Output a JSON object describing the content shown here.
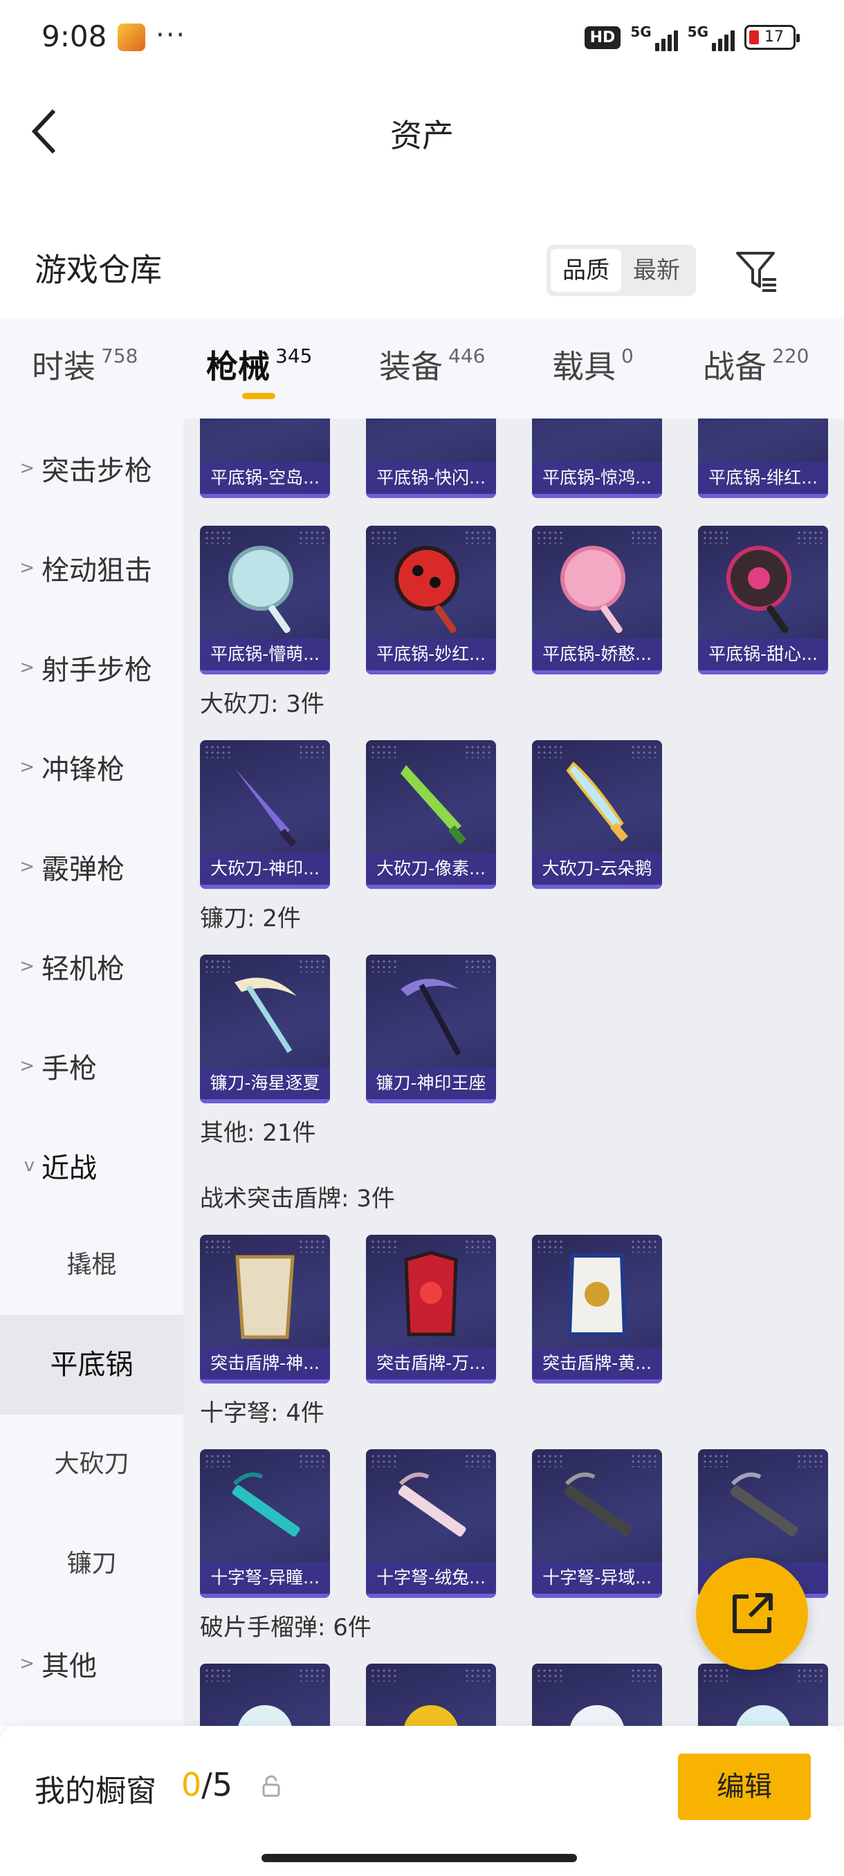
{
  "status_bar": {
    "time": "9:08",
    "dots": "···",
    "hd": "HD",
    "net1": "5G",
    "net2": "5G",
    "battery": "17"
  },
  "header": {
    "title": "资产"
  },
  "warehouse": {
    "title": "游戏仓库",
    "sort_quality": "品质",
    "sort_newest": "最新"
  },
  "tabs": [
    {
      "label": "时装",
      "count": "758"
    },
    {
      "label": "枪械",
      "count": "345"
    },
    {
      "label": "装备",
      "count": "446"
    },
    {
      "label": "载具",
      "count": "0"
    },
    {
      "label": "战备",
      "count": "220"
    }
  ],
  "sidebar": {
    "items": [
      "突击步枪",
      "栓动狙击",
      "射手步枪",
      "冲锋枪",
      "霰弹枪",
      "轻机枪",
      "手枪"
    ],
    "expanded": "近战",
    "subitems": [
      "撬棍",
      "平底锅",
      "大砍刀",
      "镰刀"
    ],
    "last": "其他"
  },
  "content": {
    "row0": [
      "平底锅-空岛...",
      "平底锅-快闪...",
      "平底锅-惊鸿...",
      "平底锅-绯红..."
    ],
    "row1": [
      "平底锅-懵萌...",
      "平底锅-妙红...",
      "平底锅-娇憨...",
      "平底锅-甜心..."
    ],
    "g_machete": "大砍刀: 3件",
    "machete": [
      "大砍刀-神印...",
      "大砍刀-像素...",
      "大砍刀-云朵鹅"
    ],
    "g_sickle": "镰刀: 2件",
    "sickle": [
      "镰刀-海星逐夏",
      "镰刀-神印王座"
    ],
    "g_other": "其他: 21件",
    "g_shield": "战术突击盾牌: 3件",
    "shield": [
      "突击盾牌-神...",
      "突击盾牌-万...",
      "突击盾牌-黄..."
    ],
    "g_crossbow": "十字弩: 4件",
    "crossbow": [
      "十字弩-异瞳...",
      "十字弩-绒兔...",
      "十字弩-异域...",
      "十字弩-..."
    ],
    "g_grenade": "破片手榴弹: 6件"
  },
  "bottom": {
    "title": "我的橱窗",
    "current": "0",
    "total": "/5",
    "edit": "编辑"
  }
}
